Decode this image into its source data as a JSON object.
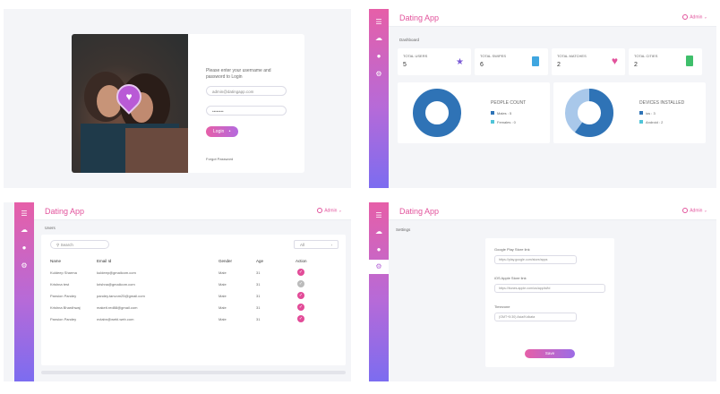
{
  "colors": {
    "accent": "#e2539c",
    "sidebar_top": "#e65fa8",
    "sidebar_bottom": "#7c6cf0",
    "donut_blue": "#2f73b6",
    "donut_light": "#a9c8ea"
  },
  "login": {
    "prompt": "Please enter your username and password to Login",
    "username_value": "admin@datingapp.com",
    "password_value": "••••••••",
    "login_label": "Login",
    "forgot_label": "Forgot Password"
  },
  "dashboard": {
    "app_title": "Dating App",
    "admin_label": "Admin",
    "breadcrumb": "Dashboard",
    "stats": [
      {
        "label": "TOTAL USERS",
        "value": "5",
        "icon": "users-icon",
        "color": "#7b5cd6"
      },
      {
        "label": "TOTAL SWIPES",
        "value": "6",
        "icon": "file-icon",
        "color": "#3fa6e0"
      },
      {
        "label": "TOTAL MATCHES",
        "value": "2",
        "icon": "heart-icon",
        "color": "#e2539c"
      },
      {
        "label": "TOTAL CITIES",
        "value": "2",
        "icon": "city-icon",
        "color": "#3fbf6b"
      }
    ],
    "people": {
      "title": "PEOPLE COUNT",
      "legend": [
        "Males : 5",
        "Females : 0"
      ]
    },
    "devices": {
      "title": "DEVICES INSTALLED",
      "legend": [
        "ios : 3",
        "Android : 2"
      ]
    }
  },
  "users": {
    "app_title": "Dating App",
    "admin_label": "Admin",
    "breadcrumb": "Users",
    "search_placeholder": "Search",
    "filter_value": "All",
    "columns": [
      "Name",
      "Email Id",
      "Gender",
      "Age",
      "Action"
    ],
    "rows": [
      {
        "name": "Kuldeep Sharma",
        "email": "kuldeep@gmailcom.com",
        "gender": "Male",
        "age": "31",
        "active": true
      },
      {
        "name": "Krishna test",
        "email": "krishna@gmailcom.com",
        "gender": "Male",
        "age": "31",
        "active": false
      },
      {
        "name": "Pansion Pandey",
        "email": "pandey.tanvom25@gmail.com",
        "gender": "Male",
        "age": "31",
        "active": true
      },
      {
        "name": "Krishna Bhardhwaj",
        "email": "makeit.red88@gmail.com",
        "gender": "Male",
        "age": "31",
        "active": true
      },
      {
        "name": "Pansion Pandey",
        "email": "nvtabn@webl.web.com",
        "gender": "Male",
        "age": "31",
        "active": true
      }
    ]
  },
  "settings": {
    "app_title": "Dating App",
    "admin_label": "Admin",
    "breadcrumb": "Settings",
    "google_label": "Google Play Store link",
    "google_value": "https://play.google.com/store/apps",
    "ios_label": "iOS Apple Store link",
    "ios_value": "https://itunes.apple.com/us/app/id/id",
    "timezone_label": "Timezone",
    "timezone_value": "(GMT+5:30) Asia/Kolkata",
    "save_label": "Save"
  }
}
